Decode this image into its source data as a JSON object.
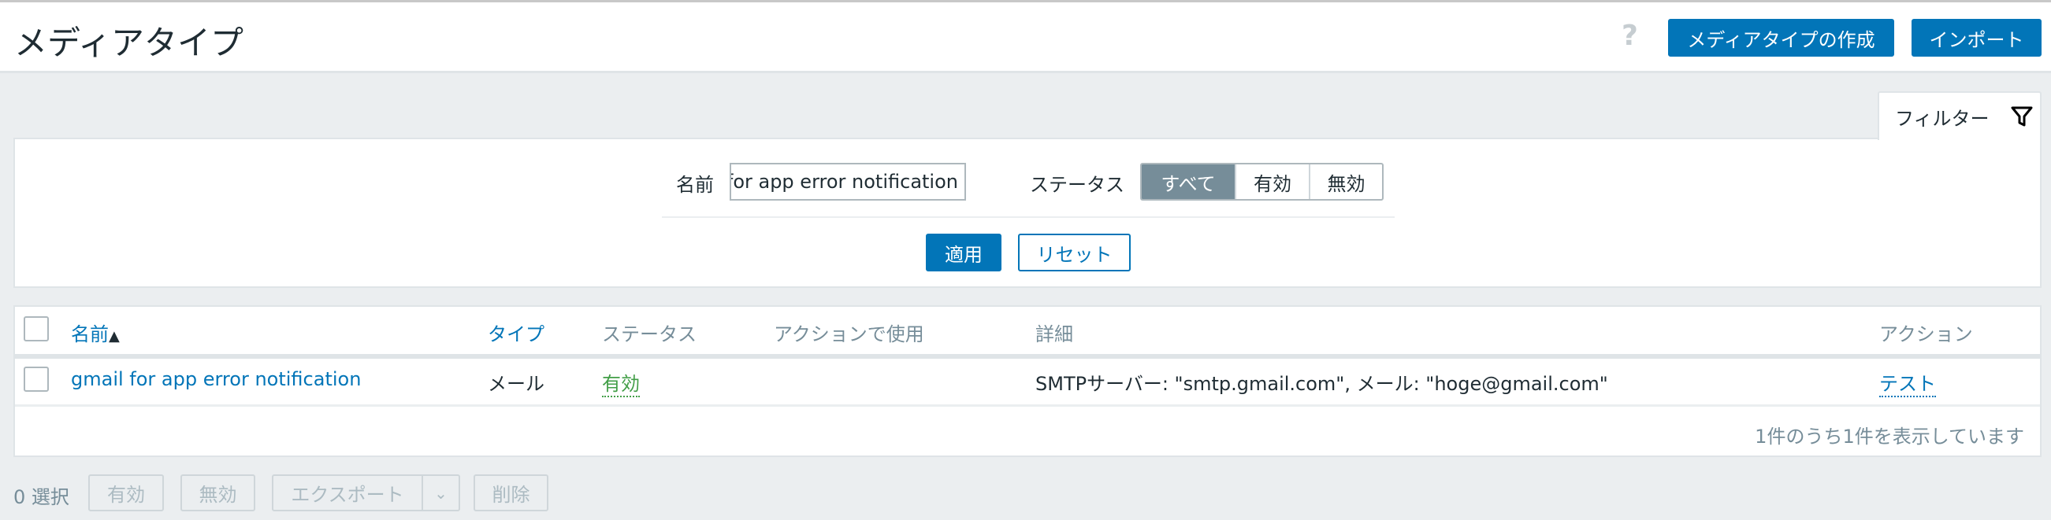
{
  "header": {
    "title": "メディアタイプ",
    "help_icon": "question-icon",
    "help_label": "?",
    "create_label": "メディアタイプの作成",
    "import_label": "インポート"
  },
  "filter": {
    "tab_label": "フィルター",
    "tab_icon": "filter-icon",
    "name_label": "名前",
    "name_value": "gmail for app error notification",
    "status_label": "ステータス",
    "status_options": [
      "すべて",
      "有効",
      "無効"
    ],
    "status_selected": "すべて",
    "apply_label": "適用",
    "reset_label": "リセット"
  },
  "table": {
    "columns": [
      "名前",
      "タイプ",
      "ステータス",
      "アクションで使用",
      "詳細",
      "アクション"
    ],
    "sort_indicator": "▲",
    "rows": [
      {
        "name": "gmail for app error notification",
        "type": "メール",
        "status": "有効",
        "used_in_actions": "",
        "details": "SMTPサーバー: \"smtp.gmail.com\", メール: \"hoge@gmail.com\"",
        "action": "テスト"
      }
    ],
    "footer": "1件のうち1件を表示しています"
  },
  "bulk": {
    "selected": "0 選択",
    "enable": "有効",
    "disable": "無効",
    "export": "エクスポート",
    "export_dropdown_icon": "chevron-down-icon",
    "delete": "削除"
  },
  "colors": {
    "accent": "#0275b8",
    "enabled": "#429e47",
    "muted": "#768d99"
  }
}
